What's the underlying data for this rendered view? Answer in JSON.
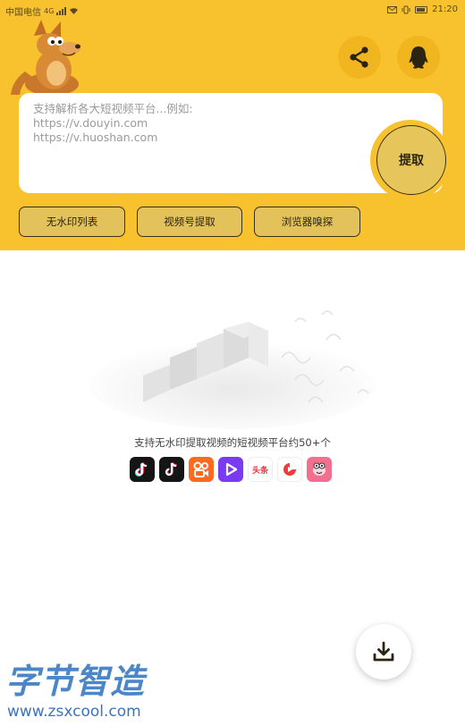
{
  "status_bar": {
    "carrier": "中国电信",
    "network": "4G",
    "time": "21:20"
  },
  "header": {
    "mascot_icon": "kangaroo-logo",
    "share_icon": "share-icon",
    "qq_icon": "qq-penguin-icon"
  },
  "input": {
    "placeholder": "支持解析各大短视频平台...例如:\nhttps://v.douyin.com\nhttps://v.huoshan.com"
  },
  "extract_button": {
    "label": "提取"
  },
  "actions": [
    {
      "label": "无水印列表"
    },
    {
      "label": "视频号提取"
    },
    {
      "label": "浏览器嗅探"
    }
  ],
  "empty_state": {
    "support_text": "支持无水印提取视频的短视频平台约50+个",
    "platforms": [
      {
        "icon": "douyin-icon"
      },
      {
        "icon": "douyin-lite-icon"
      },
      {
        "icon": "kuaishou-icon"
      },
      {
        "icon": "weishi-icon"
      },
      {
        "icon": "toutiao-icon",
        "label": "头条"
      },
      {
        "icon": "xigua-icon"
      },
      {
        "icon": "pipixia-icon"
      }
    ]
  },
  "download_icon": "download-icon",
  "watermark": {
    "title": "字节智造",
    "url": "www.zsxcool.com"
  },
  "colors": {
    "header_yellow": "#f8c12e",
    "button_fill": "#e3c25c",
    "watermark_blue": "#4a86c8"
  }
}
